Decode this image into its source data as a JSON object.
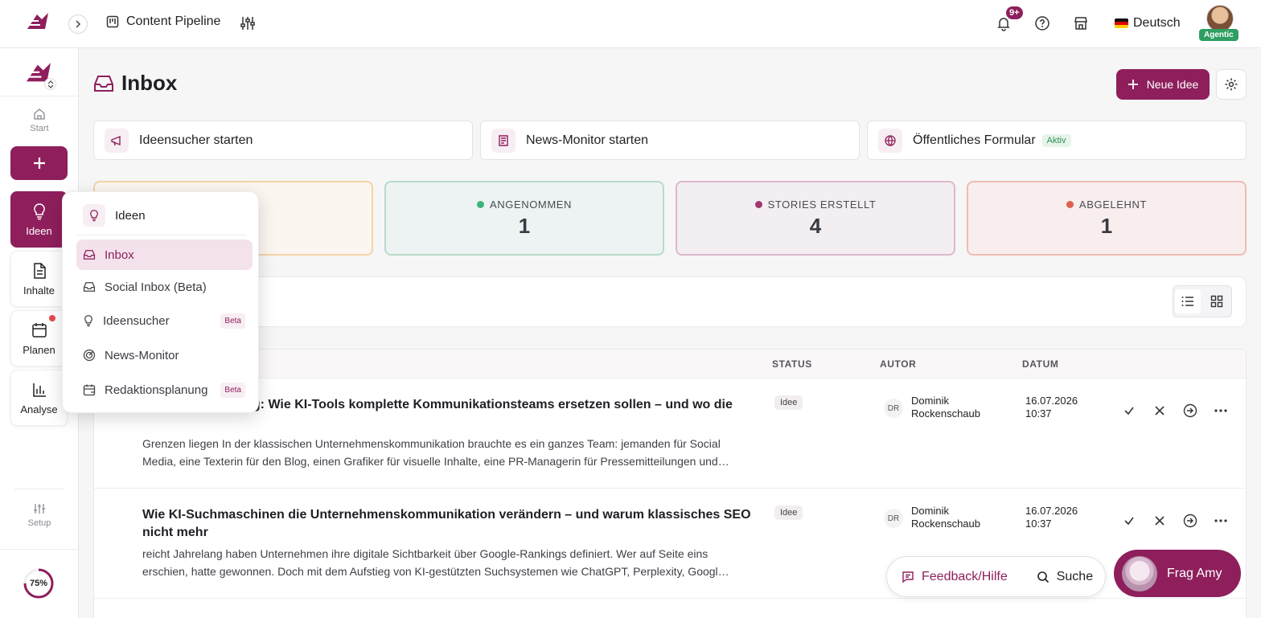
{
  "topbar": {
    "pipeline_label": "Content Pipeline",
    "notif_count": "9+",
    "language": "Deutsch",
    "agent_badge": "Agentic"
  },
  "sidebar": {
    "start": "Start",
    "items": [
      {
        "label": "Ideen",
        "icon": "lightbulb-icon"
      },
      {
        "label": "Inhalte",
        "icon": "document-icon"
      },
      {
        "label": "Planen",
        "icon": "calendar-icon"
      },
      {
        "label": "Analyse",
        "icon": "bar-chart-icon"
      }
    ],
    "setup": "Setup",
    "progress_label": "75%",
    "progress_value": 0.75
  },
  "page": {
    "title": "Inbox",
    "new_idea": "Neue Idee"
  },
  "actions": {
    "ideas_finder": "Ideensucher starten",
    "news_monitor": "News-Monitor starten",
    "public_form": "Öffentliches Formular",
    "public_form_badge": "Aktiv"
  },
  "stats": [
    {
      "label": "ANGENOMMEN",
      "value": "1",
      "color": "#3eb47b"
    },
    {
      "label": "STORIES ERSTELLT",
      "value": "4",
      "color": "#a0376f"
    },
    {
      "label": "ABGELEHNT",
      "value": "1",
      "color": "#e0614d"
    }
  ],
  "table": {
    "headers": {
      "status": "STATUS",
      "author": "AUTOR",
      "date": "DATUM"
    },
    "rows": [
      {
        "title": "Marketingabteilung: Wie KI-Tools komplette Kommunikationsteams ersetzen sollen – und wo die",
        "description": "Grenzen liegen In der klassischen Unternehmenskommunikation brauchte es ein ganzes Team: jemanden für Social Media, eine Texterin für den Blog, einen Grafiker für visuelle Inhalte, eine PR-Managerin für Pressemitteilungen und…",
        "status": "Idee",
        "initials": "DR",
        "author": "Dominik Rockenschaub",
        "date": "16.07.2026 10:37"
      },
      {
        "title": "Wie KI-Suchmaschinen die Unternehmenskommunikation verändern – und warum klassisches SEO nicht mehr",
        "description": "reicht Jahrelang haben Unternehmen ihre digitale Sichtbarkeit über Google-Rankings definiert. Wer auf Seite eins erschien, hatte gewonnen. Doch mit dem Aufstieg von KI-gestützten Suchsystemen wie ChatGPT, Perplexity, Googl…",
        "status": "Idee",
        "initials": "DR",
        "author": "Dominik Rockenschaub",
        "date": "16.07.2026 10:37"
      }
    ]
  },
  "dropdown": {
    "header": "Ideen",
    "items": [
      {
        "label": "Inbox",
        "badge": ""
      },
      {
        "label": "Social Inbox (Beta)",
        "badge": ""
      },
      {
        "label": "Ideensucher",
        "badge": "Beta"
      },
      {
        "label": "News-Monitor",
        "badge": ""
      },
      {
        "label": "Redaktionsplanung",
        "badge": "Beta"
      }
    ]
  },
  "floating": {
    "feedback": "Feedback/Hilfe",
    "search": "Suche",
    "amy": "Frag Amy"
  },
  "colors": {
    "brand": "#8e1f5c",
    "accepted": "#3eb47b",
    "stories": "#a0376f",
    "rejected": "#e0614d",
    "new": "#f0c48a"
  }
}
